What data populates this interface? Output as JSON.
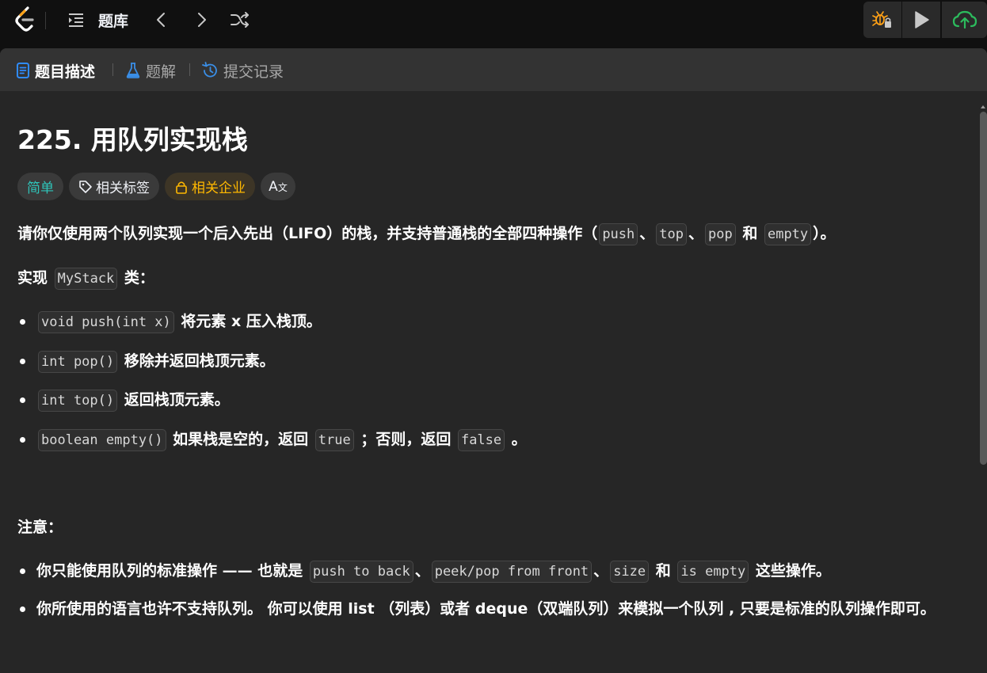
{
  "navbar": {
    "title": "题库",
    "icons": [
      "leetcode-logo",
      "list-icon",
      "chevron-left-icon",
      "chevron-right-icon",
      "shuffle-icon",
      "debug-icon",
      "play-icon",
      "cloud-upload-icon"
    ],
    "accent": "#ffa116",
    "submit_color": "#2cbb5d"
  },
  "tabs": [
    {
      "label": "题目描述",
      "icon": "document-icon"
    },
    {
      "label": "题解",
      "icon": "flask-icon"
    },
    {
      "label": "提交记录",
      "icon": "history-icon"
    }
  ],
  "problem": {
    "title": "225. 用队列实现栈",
    "tags": {
      "difficulty": "简单",
      "topics": "相关标签",
      "companies": "相关企业",
      "translate": "A"
    },
    "intro": {
      "text_before": "请你仅使用两个队列实现一个后入先出（LIFO）的栈，并支持普通栈的全部四种操作（",
      "ops": [
        "push",
        "top",
        "pop",
        "empty"
      ],
      "sep1": "、",
      "sep2": "、",
      "sep3": " 和 ",
      "text_after": "）。"
    },
    "implement": {
      "prefix": "实现",
      "class_name": "MyStack",
      "suffix": "类："
    },
    "methods": [
      {
        "code": "void push(int x)",
        "text": " 将元素 x 压入栈顶。"
      },
      {
        "code": "int pop()",
        "text": " 移除并返回栈顶元素。"
      },
      {
        "code": "int top()",
        "text": " 返回栈顶元素。"
      },
      {
        "code": "boolean empty()",
        "text": " 如果栈是空的，返回 ",
        "code2": "true",
        "text2": " ；否则，返回 ",
        "code3": "false",
        "text3": " 。"
      }
    ],
    "notes_heading": "注意：",
    "notes": [
      {
        "text_before": "你只能使用队列的标准操作 —— 也就是 ",
        "codes": [
          "push to back",
          "peek/pop from front",
          "size",
          "is empty"
        ],
        "sep1": "、",
        "sep2": "、",
        "sep3": " 和 ",
        "text_after": " 这些操作。"
      },
      {
        "text": "你所使用的语言也许不支持队列。 你可以使用 list （列表）或者 deque（双端队列）来模拟一个队列 , 只要是标准的队列操作即可。"
      }
    ]
  }
}
